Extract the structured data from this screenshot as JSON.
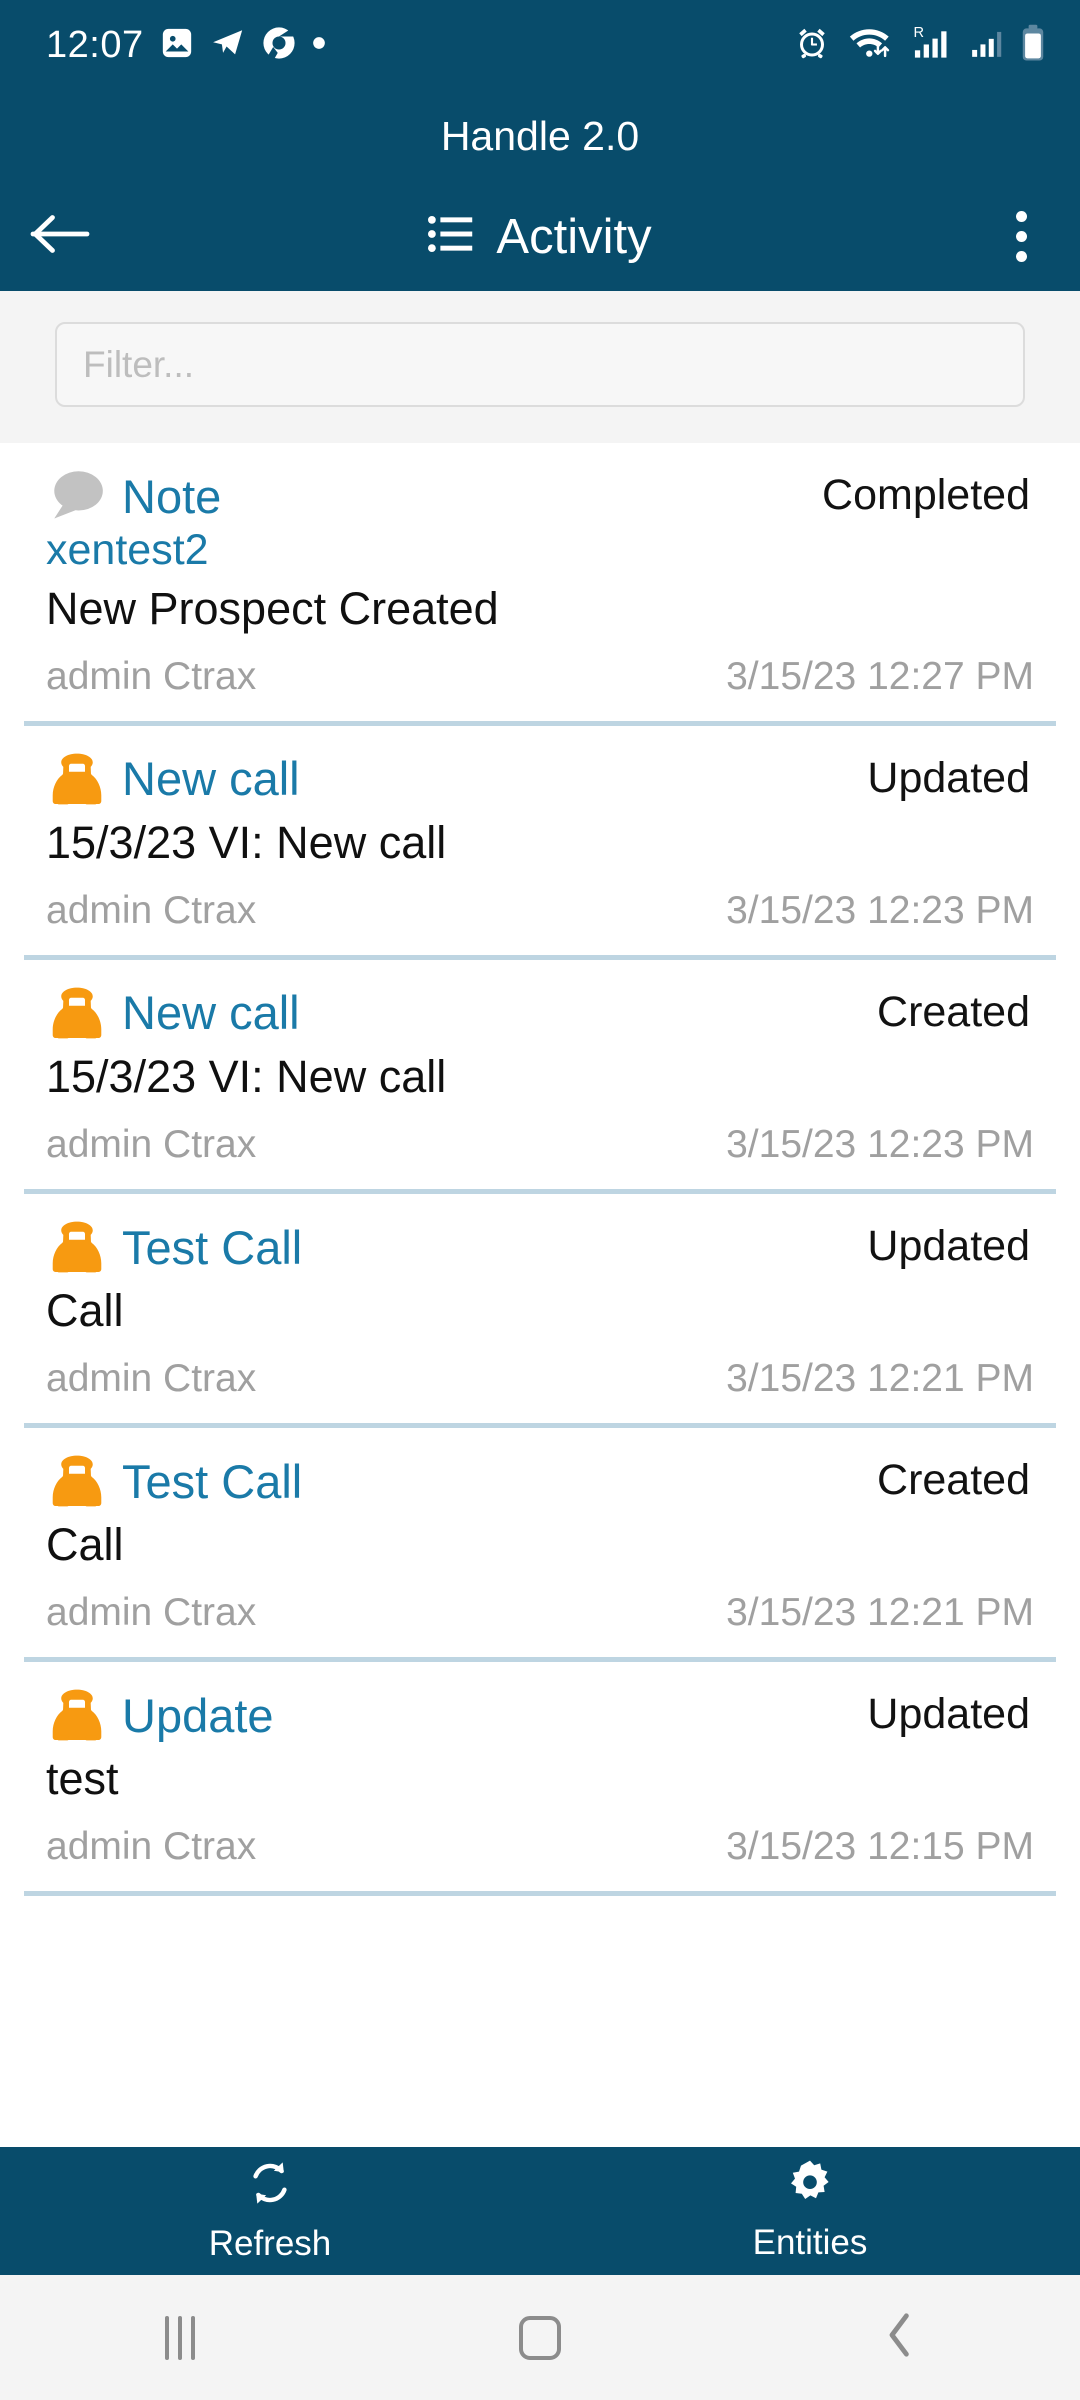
{
  "status_bar": {
    "clock": "12:07",
    "left_icons": [
      "image-icon",
      "telegram-icon",
      "chrome-icon",
      "dot-icon"
    ],
    "right_icons": [
      "alarm-icon",
      "wifi-icon",
      "signal-roaming-icon",
      "signal-icon",
      "battery-icon"
    ]
  },
  "header": {
    "app_title": "Handle 2.0"
  },
  "action_bar": {
    "back_icon": "arrow-left-icon",
    "list_icon": "list-icon",
    "title": "Activity",
    "overflow_icon": "more-vertical-icon"
  },
  "filter": {
    "placeholder": "Filter...",
    "value": ""
  },
  "colors": {
    "primary": "#084c6b",
    "link": "#1a7aa8",
    "accent_orange": "#f79a11",
    "icon_gray": "#c2c2c2",
    "divider": "#bed5e2",
    "muted_text": "#a0a0a0"
  },
  "activity_list": [
    {
      "icon": "speech-bubble-icon",
      "title": "Note",
      "status": "Completed",
      "subtitle": "xentest2",
      "body": "New Prospect Created",
      "user": "admin Ctrax",
      "timestamp": "3/15/23 12:27 PM"
    },
    {
      "icon": "telephone-icon",
      "title": "New call",
      "status": "Updated",
      "subtitle": "",
      "body": "15/3/23 VI: New call",
      "user": "admin Ctrax",
      "timestamp": "3/15/23 12:23 PM"
    },
    {
      "icon": "telephone-icon",
      "title": "New call",
      "status": "Created",
      "subtitle": "",
      "body": "15/3/23 VI: New call",
      "user": "admin Ctrax",
      "timestamp": "3/15/23 12:23 PM"
    },
    {
      "icon": "telephone-icon",
      "title": "Test Call",
      "status": "Updated",
      "subtitle": "",
      "body": "Call",
      "user": "admin Ctrax",
      "timestamp": "3/15/23 12:21 PM"
    },
    {
      "icon": "telephone-icon",
      "title": "Test Call",
      "status": "Created",
      "subtitle": "",
      "body": "Call",
      "user": "admin Ctrax",
      "timestamp": "3/15/23 12:21 PM"
    },
    {
      "icon": "telephone-icon",
      "title": "Update",
      "status": "Updated",
      "subtitle": "",
      "body": "test",
      "user": "admin Ctrax",
      "timestamp": "3/15/23 12:15 PM"
    }
  ],
  "bottom_bar": [
    {
      "icon": "refresh-icon",
      "label": "Refresh"
    },
    {
      "icon": "gear-icon",
      "label": "Entities"
    }
  ],
  "android_nav": {
    "recents": "recents-icon",
    "home": "home-icon",
    "back": "back-chevron-icon"
  }
}
